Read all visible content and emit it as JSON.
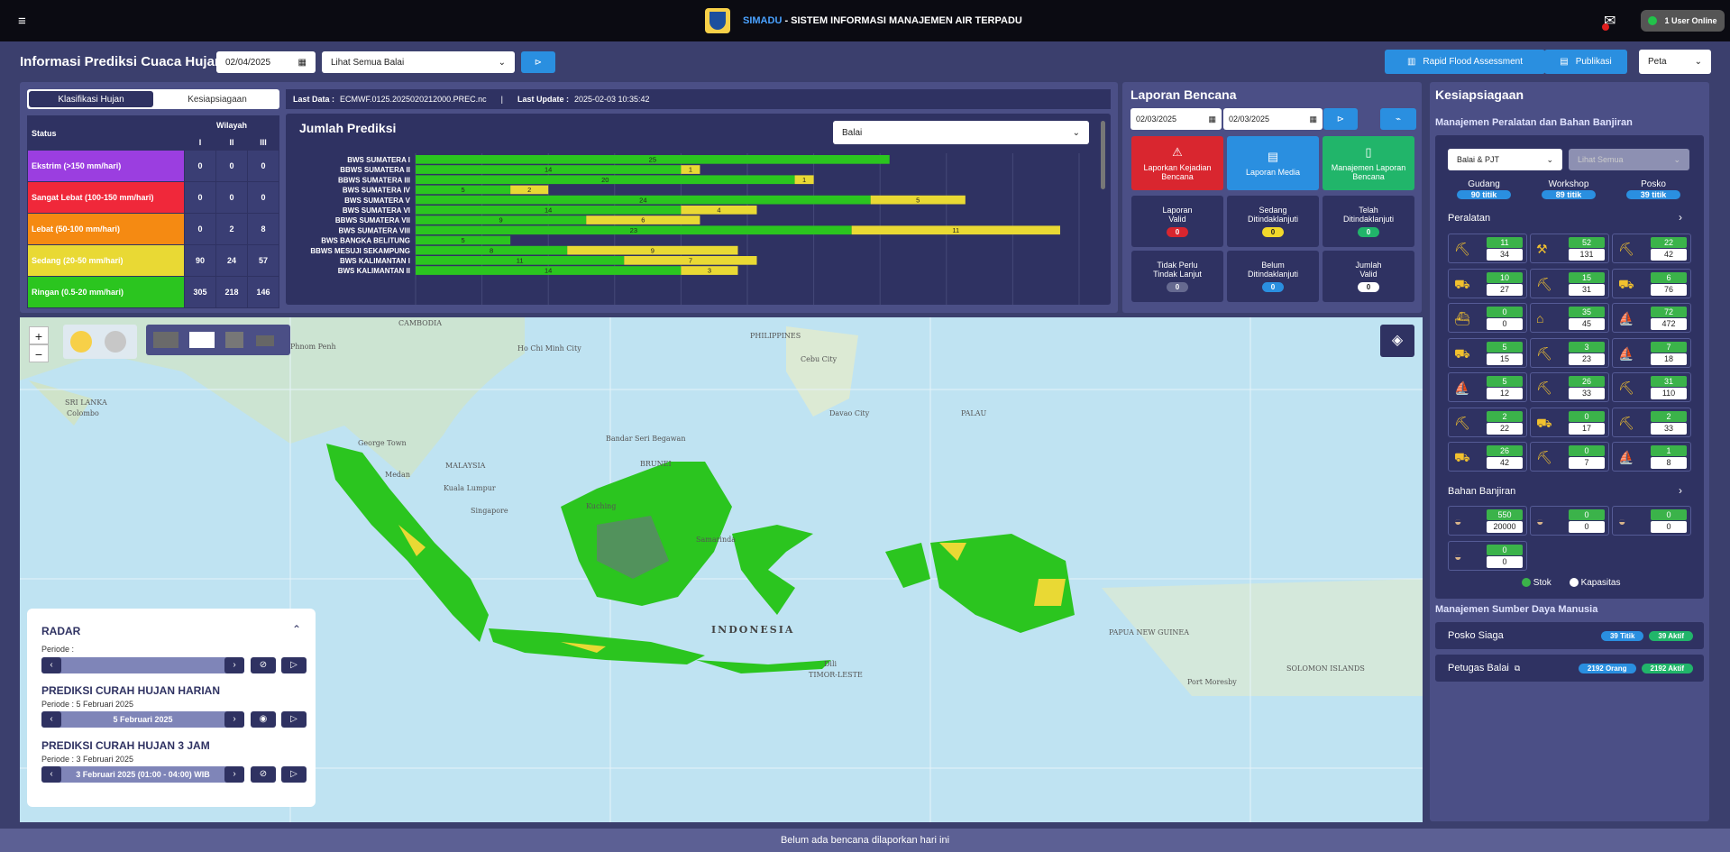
{
  "topbar": {
    "brand_name": "SIMADU",
    "brand_title": " - SISTEM INFORMASI MANAJEMEN AIR TERPADU",
    "mail_count": "0",
    "online": "1 User Online"
  },
  "header": {
    "title": "Informasi Prediksi Cuaca Hujan",
    "date": "02/04/2025",
    "balai_select": "Lihat Semua Balai",
    "rfa_button": "Rapid Flood Assessment",
    "publikasi_button": "Publikasi",
    "view_select": "Peta"
  },
  "klasifikasi": {
    "tabs": [
      "Klasifikasi Hujan",
      "Kesiapsiagaan"
    ],
    "col_status": "Status",
    "col_wilayah": "Wilayah",
    "regions": [
      "I",
      "II",
      "III"
    ],
    "rows": [
      {
        "label": "Ekstrim (>150 mm/hari)",
        "color": "#9b3ee0",
        "v": [
          "0",
          "0",
          "0"
        ]
      },
      {
        "label": "Sangat Lebat (100-150 mm/hari)",
        "color": "#f0283a",
        "v": [
          "0",
          "0",
          "0"
        ]
      },
      {
        "label": "Lebat (50-100 mm/hari)",
        "color": "#f58a12",
        "v": [
          "0",
          "2",
          "8"
        ]
      },
      {
        "label": "Sedang (20-50 mm/hari)",
        "color": "#e9d934",
        "v": [
          "90",
          "24",
          "57"
        ]
      },
      {
        "label": "Ringan (0.5-20 mm/hari)",
        "color": "#2bc51f",
        "v": [
          "305",
          "218",
          "146"
        ]
      }
    ]
  },
  "lastdata": {
    "data_label": "Last Data :",
    "data_value": "ECMWF.0125.2025020212000.PREC.nc",
    "sep": "|",
    "update_label": "Last Update :",
    "update_value": "2025-02-03 10:35:42"
  },
  "chart_data": {
    "type": "bar",
    "title": "Jumlah Prediksi",
    "select": "Balai",
    "categories": [
      "BWS SUMATERA I",
      "BBWS SUMATERA II",
      "BBWS SUMATERA III",
      "BWS SUMATERA IV",
      "BWS SUMATERA V",
      "BWS SUMATERA VI",
      "BBWS SUMATERA VII",
      "BWS SUMATERA VIII",
      "BWS BANGKA BELITUNG",
      "BBWS MESUJI SEKAMPUNG",
      "BWS KALIMANTAN I",
      "BWS KALIMANTAN II"
    ],
    "series": [
      {
        "name": "Ringan",
        "color": "#2bc51f",
        "values": [
          25,
          14,
          20,
          5,
          24,
          14,
          9,
          23,
          5,
          8,
          11,
          14
        ]
      },
      {
        "name": "Sedang",
        "color": "#e9d934",
        "values": [
          0,
          1,
          1,
          2,
          5,
          4,
          6,
          11,
          0,
          9,
          7,
          3
        ]
      }
    ],
    "xlim": [
      0,
      35
    ]
  },
  "laporan": {
    "title": "Laporan Bencana",
    "date_from": "02/03/2025",
    "date_to": "02/03/2025",
    "cards": [
      {
        "label": "Laporkan Kejadian Bencana",
        "color": "#d9262f"
      },
      {
        "label": "Laporan Media",
        "color": "#2a8fe0"
      },
      {
        "label": "Manajemen Laporan Bencana",
        "color": "#21b56a"
      }
    ],
    "stats": [
      {
        "l1": "Laporan",
        "l2": "Valid",
        "v": "0",
        "bg": "#d9262f",
        "fg": "#fff"
      },
      {
        "l1": "Sedang",
        "l2": "Ditindaklanjuti",
        "v": "0",
        "bg": "#f2d82b",
        "fg": "#222"
      },
      {
        "l1": "Telah",
        "l2": "Ditindaklanjuti",
        "v": "0",
        "bg": "#21b56a",
        "fg": "#fff"
      },
      {
        "l1": "Tidak Perlu",
        "l2": "Tindak Lanjut",
        "v": "0",
        "bg": "#666a90",
        "fg": "#fff"
      },
      {
        "l1": "Belum",
        "l2": "Ditindaklanjuti",
        "v": "0",
        "bg": "#2a8fe0",
        "fg": "#fff"
      },
      {
        "l1": "Jumlah",
        "l2": "Valid",
        "v": "0",
        "bg": "#ffffff",
        "fg": "#222"
      }
    ]
  },
  "kesiapsiagaan": {
    "title": "Kesiapsiagaan",
    "sub1": "Manajemen Peralatan dan Bahan Banjiran",
    "select1": "Balai & PJT",
    "select2": "Lihat Semua",
    "stores": [
      {
        "label": "Gudang",
        "value": "90 titik"
      },
      {
        "label": "Workshop",
        "value": "89 titik"
      },
      {
        "label": "Posko",
        "value": "39 titik"
      }
    ],
    "peralatan_title": "Peralatan",
    "peralatan": [
      [
        "11",
        "34"
      ],
      [
        "52",
        "131"
      ],
      [
        "22",
        "42"
      ],
      [
        "10",
        "27"
      ],
      [
        "15",
        "31"
      ],
      [
        "6",
        "76"
      ],
      [
        "0",
        "0"
      ],
      [
        "35",
        "45"
      ],
      [
        "72",
        "472"
      ],
      [
        "5",
        "15"
      ],
      [
        "3",
        "23"
      ],
      [
        "7",
        "18"
      ],
      [
        "5",
        "12"
      ],
      [
        "26",
        "33"
      ],
      [
        "31",
        "110"
      ],
      [
        "2",
        "22"
      ],
      [
        "0",
        "17"
      ],
      [
        "2",
        "33"
      ],
      [
        "26",
        "42"
      ],
      [
        "0",
        "7"
      ],
      [
        "1",
        "8"
      ]
    ],
    "bahan_title": "Bahan Banjiran",
    "bahan": [
      [
        "550",
        "20000"
      ],
      [
        "0",
        "0"
      ],
      [
        "0",
        "0"
      ],
      [
        "0",
        "0"
      ]
    ],
    "legend_stok": "Stok",
    "legend_kapasitas": "Kapasitas",
    "sdm_title": "Manajemen Sumber Daya Manusia",
    "posko": {
      "label": "Posko Siaga",
      "p1": "39 Titik",
      "p2": "39 Aktif"
    },
    "petugas": {
      "label": "Petugas Balai",
      "p1": "2192 Orang",
      "p2": "2192 Aktif"
    }
  },
  "radar": {
    "title": "RADAR",
    "periode_label": "Periode :",
    "harian_title": "PREDIKSI CURAH HUJAN HARIAN",
    "harian_periode": "Periode : 5 Februari 2025",
    "harian_value": "5 Februari 2025",
    "jam_title": "PREDIKSI CURAH HUJAN 3 JAM",
    "jam_periode": "Periode : 3 Februari 2025",
    "jam_value": "3 Februari 2025 (01:00 - 04:00) WIB"
  },
  "map_labels": [
    {
      "t": "CAMBODIA"
    },
    {
      "t": "PHILIPPINES"
    },
    {
      "t": "Cebu City"
    },
    {
      "t": "Davao City"
    },
    {
      "t": "PALAU"
    },
    {
      "t": "SRI LANKA"
    },
    {
      "t": "Colombo"
    },
    {
      "t": "George Town"
    },
    {
      "t": "MALAYSIA"
    },
    {
      "t": "Medan"
    },
    {
      "t": "Kuala Lumpur"
    },
    {
      "t": "Singapore"
    },
    {
      "t": "Bandar Seri Begawan"
    },
    {
      "t": "BRUNEI"
    },
    {
      "t": "Kuching"
    },
    {
      "t": "Samarinda"
    },
    {
      "t": "INDONESIA"
    },
    {
      "t": "Dili"
    },
    {
      "t": "TIMOR-LESTE"
    },
    {
      "t": "PAPUA NEW GUINEA"
    },
    {
      "t": "Port Moresby"
    },
    {
      "t": "SOLOMON ISLANDS"
    },
    {
      "t": "Phnom Penh"
    },
    {
      "t": "Ho Chi Minh City"
    }
  ],
  "footer": "Belum ada bencana dilaporkan hari ini"
}
